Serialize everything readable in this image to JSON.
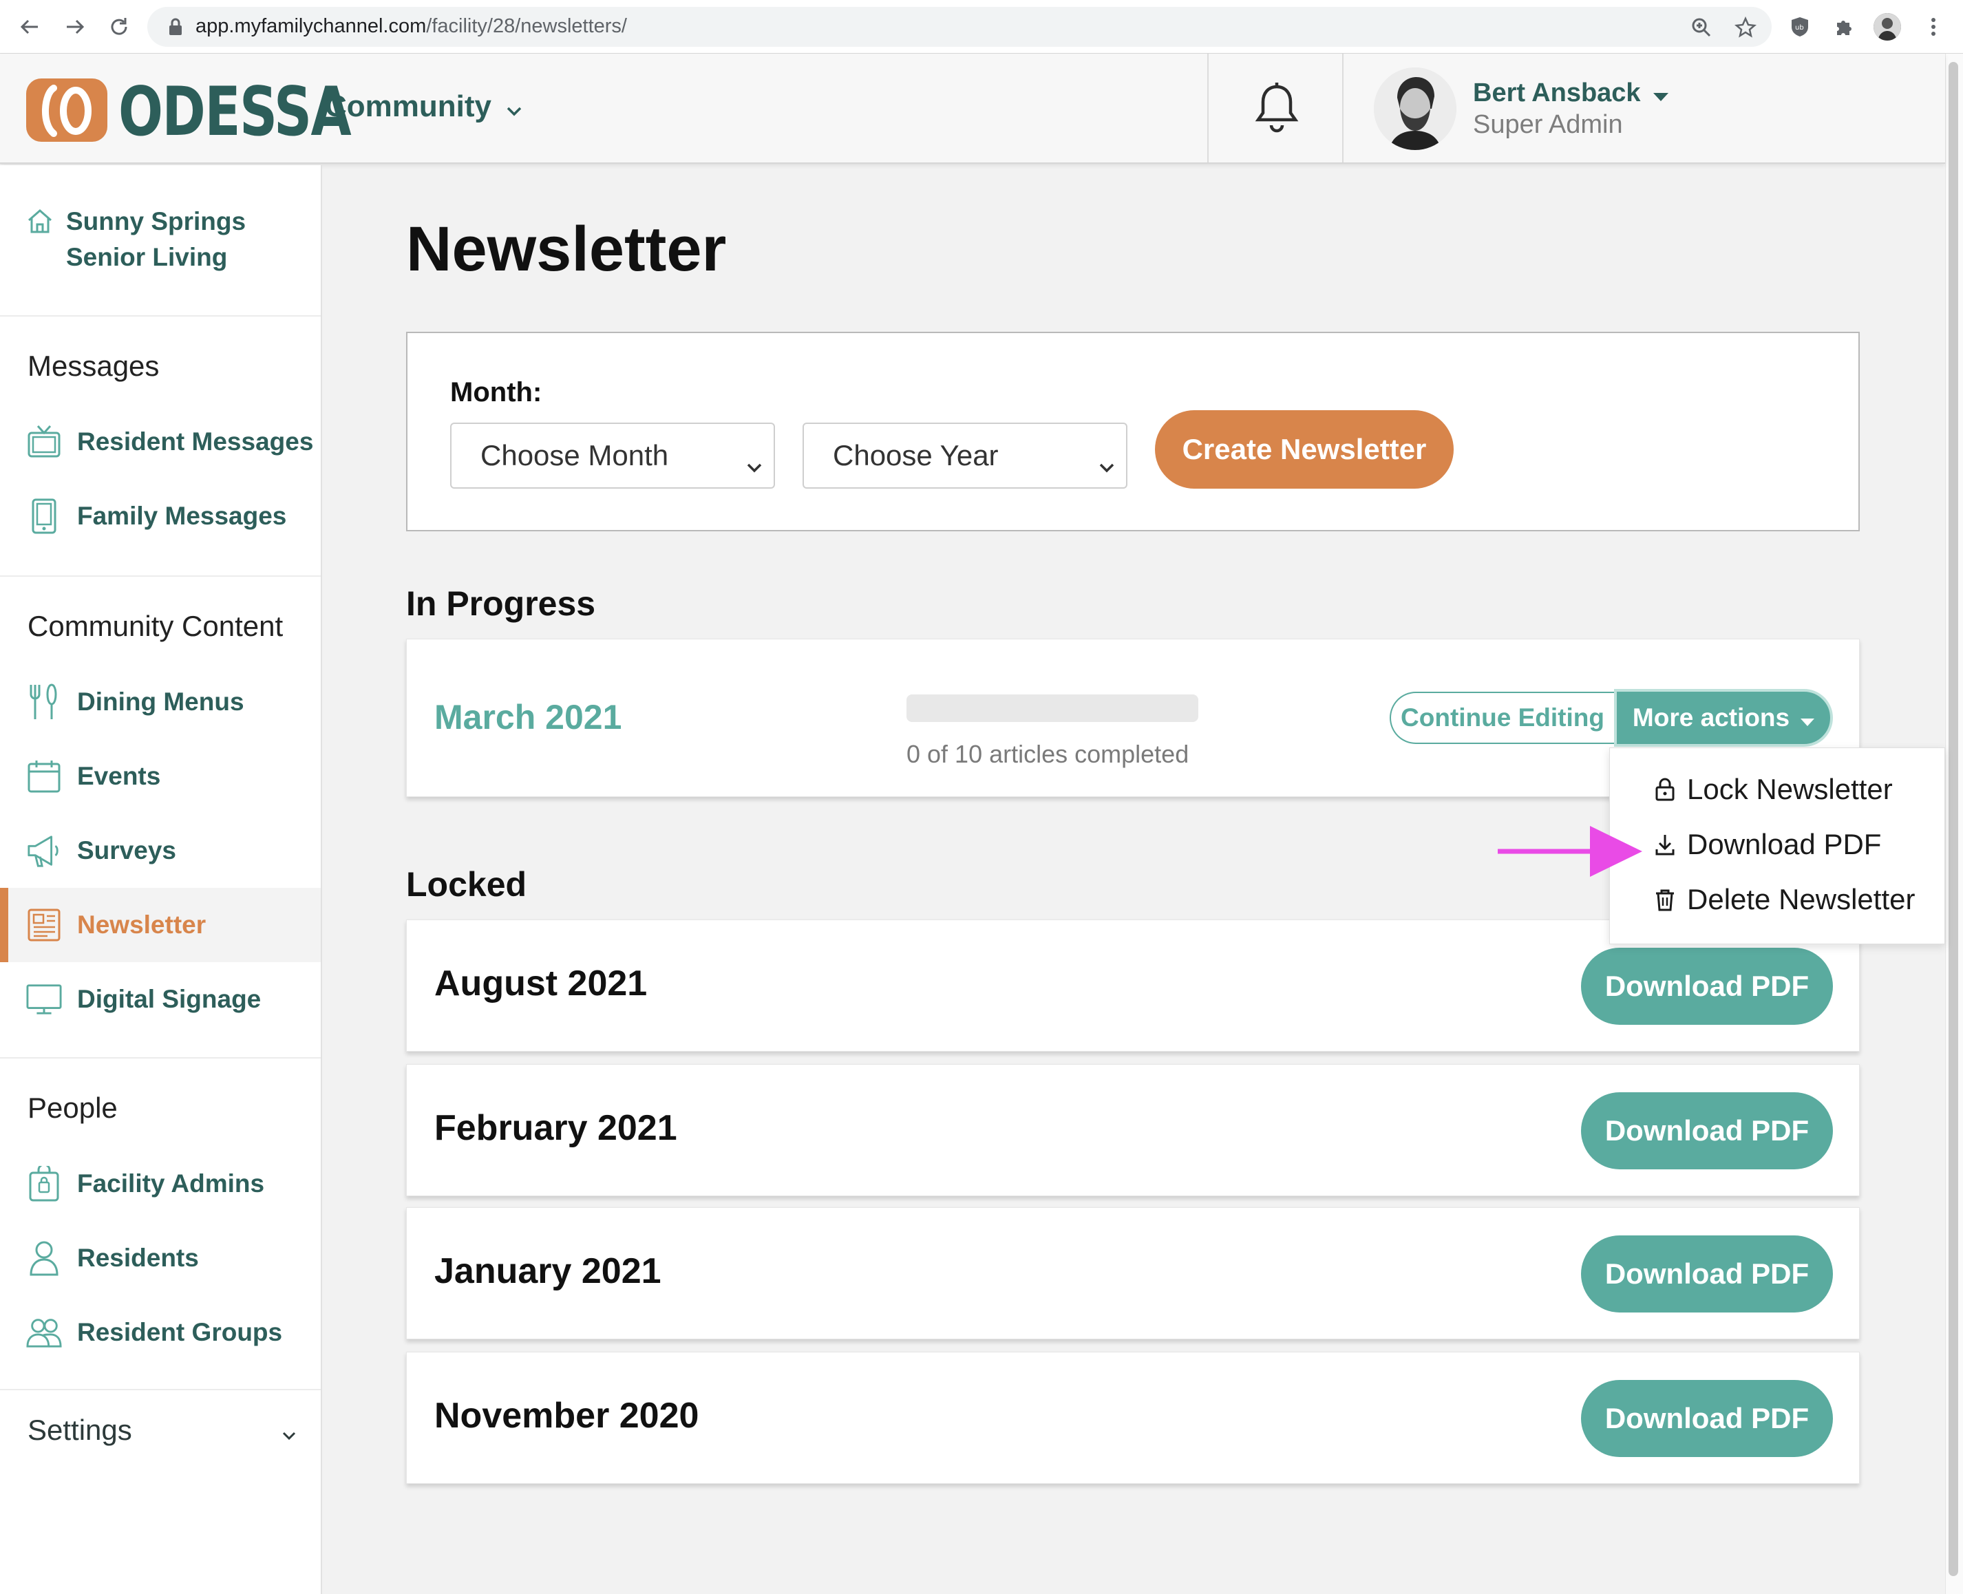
{
  "browser": {
    "url_host": "app.myfamilychannel.com",
    "url_path": "/facility/28/newsletters/"
  },
  "header": {
    "logo_text": "ODESSA",
    "community_label": "Community",
    "user_name": "Bert Ansback",
    "user_role": "Super Admin"
  },
  "sidebar": {
    "facility_line1": "Sunny Springs",
    "facility_line2": "Senior Living",
    "sections": [
      {
        "heading": "Messages",
        "items": [
          {
            "label": "Resident Messages",
            "icon": "tv-icon"
          },
          {
            "label": "Family Messages",
            "icon": "tablet-icon"
          }
        ]
      },
      {
        "heading": "Community Content",
        "items": [
          {
            "label": "Dining Menus",
            "icon": "utensils-icon"
          },
          {
            "label": "Events",
            "icon": "calendar-icon"
          },
          {
            "label": "Surveys",
            "icon": "megaphone-icon"
          },
          {
            "label": "Newsletter",
            "icon": "newspaper-icon",
            "active": true
          },
          {
            "label": "Digital Signage",
            "icon": "monitor-icon"
          }
        ]
      },
      {
        "heading": "People",
        "items": [
          {
            "label": "Facility Admins",
            "icon": "lock-badge-icon"
          },
          {
            "label": "Residents",
            "icon": "person-icon"
          },
          {
            "label": "Resident Groups",
            "icon": "group-icon"
          }
        ]
      }
    ],
    "settings_label": "Settings"
  },
  "main": {
    "title": "Newsletter",
    "create": {
      "month_label": "Month:",
      "month_select": "Choose Month",
      "year_select": "Choose Year",
      "create_button": "Create Newsletter"
    },
    "in_progress_heading": "In Progress",
    "in_progress": {
      "title": "March 2021",
      "progress": 0,
      "progress_text": "0 of 10 articles completed",
      "continue_button": "Continue Editing",
      "more_button": "More actions"
    },
    "locked_heading": "Locked",
    "locked": [
      {
        "title": "August 2021",
        "button": "Download PDF"
      },
      {
        "title": "February 2021",
        "button": "Download PDF"
      },
      {
        "title": "January 2021",
        "button": "Download PDF"
      },
      {
        "title": "November 2020",
        "button": "Download PDF"
      }
    ],
    "menu": [
      {
        "label": "Lock Newsletter",
        "icon": "lock-icon"
      },
      {
        "label": "Download PDF",
        "icon": "download-icon"
      },
      {
        "label": "Delete Newsletter",
        "icon": "trash-icon"
      }
    ]
  },
  "colors": {
    "teal": "#5aab9f",
    "dark_teal": "#2d5e5a",
    "orange": "#d8854b",
    "annotation_arrow": "#e94be6"
  }
}
